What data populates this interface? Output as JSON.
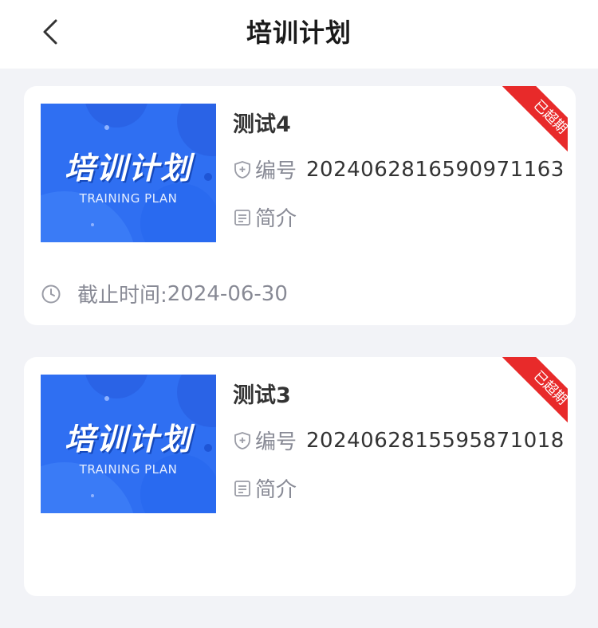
{
  "header": {
    "title": "培训计划",
    "back_icon": "chevron-left-icon"
  },
  "cover": {
    "main_text": "培训计划",
    "sub_text": "TRAINING PLAN",
    "bg_color": "#2f6ff2"
  },
  "labels": {
    "number": "编号",
    "intro": "简介",
    "deadline_prefix": "截止时间:"
  },
  "cards": [
    {
      "title": "测试4",
      "number": "20240628165909711 63",
      "number_display": "2024062816590971163",
      "deadline": "2024-06-30",
      "status": "已超期"
    },
    {
      "title": "测试3",
      "number_display": "2024062815595871018",
      "deadline": "",
      "status": "已超期"
    }
  ],
  "colors": {
    "background": "#f2f3f7",
    "card": "#ffffff",
    "status_red": "#e82a2a",
    "muted_text": "#888a95"
  }
}
